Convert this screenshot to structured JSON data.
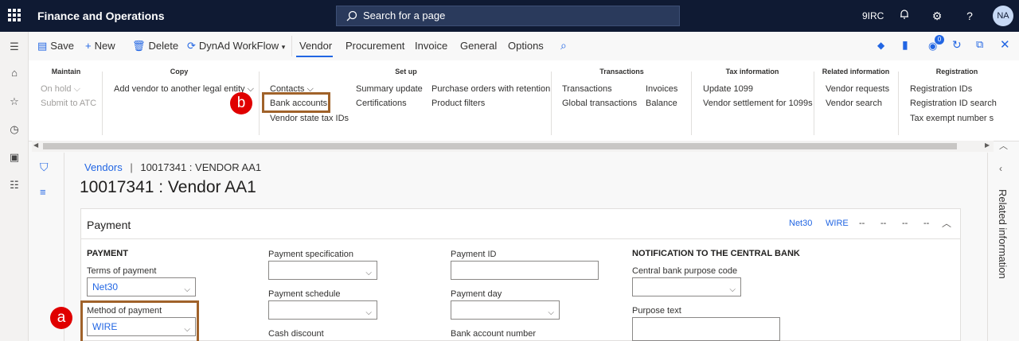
{
  "topbar": {
    "app_title": "Finance and Operations",
    "search_placeholder": "Search for a page",
    "company": "9IRC",
    "user_initials": "NA"
  },
  "actionbar": {
    "save": "Save",
    "new": "New",
    "delete": "Delete",
    "workflow": "DynAd WorkFlow",
    "tabs": [
      "Vendor",
      "Procurement",
      "Invoice",
      "General",
      "Options"
    ],
    "notification_count": "0"
  },
  "ribbon": {
    "maintain": {
      "title": "Maintain",
      "items": [
        "On hold",
        "Submit to ATC"
      ]
    },
    "copy": {
      "title": "Copy",
      "items": [
        "Add vendor to another legal entity"
      ]
    },
    "setup": {
      "title": "Set up",
      "col1": [
        "Contacts",
        "Bank accounts",
        "Vendor state tax IDs"
      ],
      "col2": [
        "Summary update",
        "Certifications"
      ],
      "col3": [
        "Purchase orders with retention",
        "Product filters"
      ]
    },
    "transactions": {
      "title": "Transactions",
      "col1": [
        "Transactions",
        "Global transactions"
      ],
      "col2": [
        "Invoices",
        "Balance"
      ]
    },
    "tax": {
      "title": "Tax information",
      "items": [
        "Update 1099",
        "Vendor settlement for 1099s"
      ]
    },
    "related": {
      "title": "Related information",
      "items": [
        "Vendor requests",
        "Vendor search"
      ]
    },
    "registration": {
      "title": "Registration",
      "items": [
        "Registration IDs",
        "Registration ID search",
        "Tax exempt number sea"
      ]
    }
  },
  "page": {
    "breadcrumb_link": "Vendors",
    "breadcrumb_sep": "|",
    "breadcrumb_current": "10017341 : VENDOR AA1",
    "title": "10017341 : Vendor AA1"
  },
  "payment": {
    "title": "Payment",
    "summary": [
      "Net30",
      "WIRE",
      "--",
      "--",
      "--",
      "--"
    ],
    "section_payment": "PAYMENT",
    "terms_label": "Terms of payment",
    "terms_value": "Net30",
    "method_label": "Method of payment",
    "method_value": "WIRE",
    "spec_label": "Payment specification",
    "schedule_label": "Payment schedule",
    "cash_label": "Cash discount",
    "payid_label": "Payment ID",
    "payday_label": "Payment day",
    "bank_label": "Bank account number",
    "section_notify": "NOTIFICATION TO THE CENTRAL BANK",
    "purpose_code_label": "Central bank purpose code",
    "purpose_text_label": "Purpose text"
  },
  "annotations": {
    "a": "a",
    "b": "b"
  },
  "side_panel": {
    "label": "Related information"
  },
  "colors": {
    "topbar": "#0f1a33",
    "accent": "#2266e3",
    "highlight": "#a0622a",
    "badge": "#e00000"
  }
}
